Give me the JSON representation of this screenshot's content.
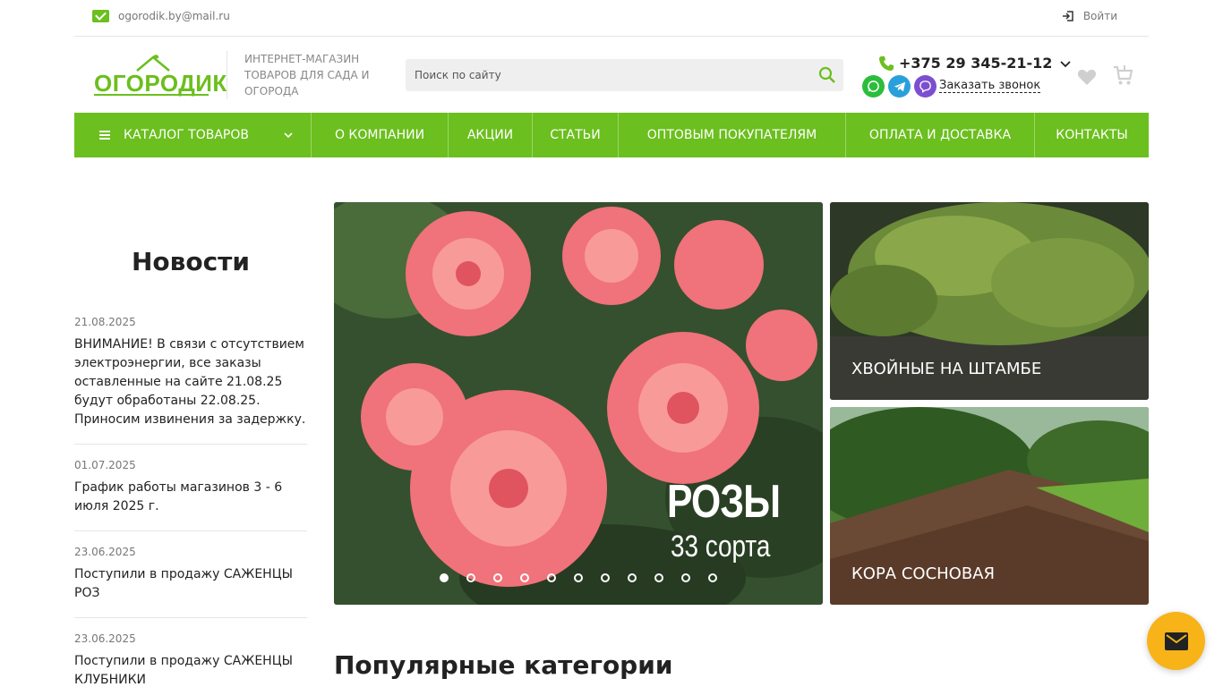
{
  "topbar": {
    "email": "ogorodik.by@mail.ru",
    "login_label": "Войти"
  },
  "header": {
    "logo_text": "ОГОРОДИК",
    "tagline": "ИНТЕРНЕТ-МАГАЗИН ТОВАРОВ ДЛЯ САДА И ОГОРОДА",
    "search_placeholder": "Поиск по сайту",
    "phone": "+375 29 345-21-12",
    "callback_label": "Заказать звонок"
  },
  "nav": {
    "catalog": "КАТАЛОГ ТОВАРОВ",
    "items": [
      "О КОМПАНИИ",
      "АКЦИИ",
      "СТАТЬИ",
      "ОПТОВЫМ ПОКУПАТЕЛЯМ",
      "ОПЛАТА И ДОСТАВКА",
      "КОНТАКТЫ"
    ]
  },
  "news": {
    "title": "Новости",
    "entries": [
      {
        "date": "21.08.2025",
        "text": "ВНИМАНИЕ! В связи с отсутствием электроэнергии, все заказы оставленные на сайте 21.08.25 будут обработаны 22.08.25. Приносим извинения за задержку."
      },
      {
        "date": "01.07.2025",
        "text": "График работы магазинов 3 - 6 июля 2025 г."
      },
      {
        "date": "23.06.2025",
        "text": "Поступили в продажу САЖЕНЦЫ РОЗ"
      },
      {
        "date": "23.06.2025",
        "text": "Поступили в продажу САЖЕНЦЫ КЛУБНИКИ"
      }
    ]
  },
  "banner": {
    "title": "РОЗЫ",
    "subtitle": "33 сорта",
    "slide_count": 11,
    "active_slide": 1
  },
  "promos": [
    {
      "label": "ХВОЙНЫЕ НА ШТАМБЕ"
    },
    {
      "label": "КОРА СОСНОВАЯ"
    }
  ],
  "popular_title": "Популярные категории",
  "colors": {
    "accent": "#6bbf1e",
    "chat": "#f7b318"
  }
}
